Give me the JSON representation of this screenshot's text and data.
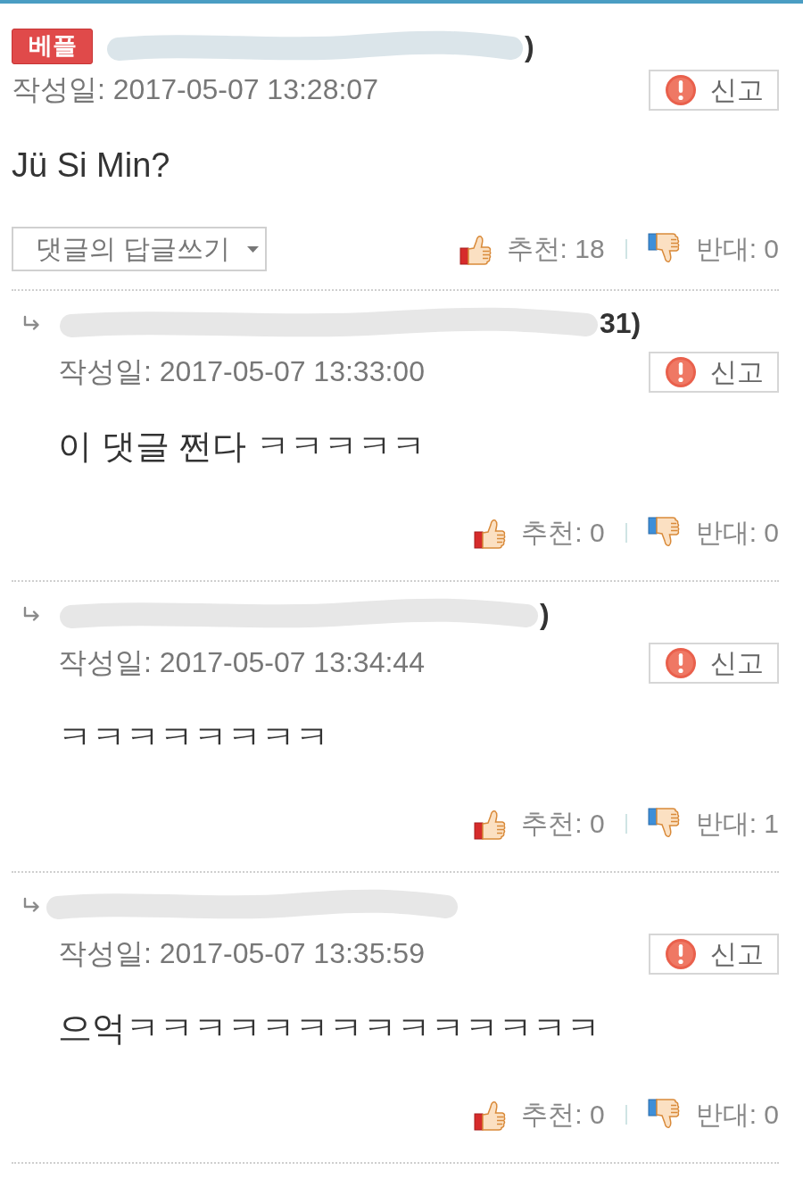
{
  "comments": [
    {
      "kind": "comment",
      "badge": "베플",
      "author_fragment": ")",
      "date": "작성일: 2017-05-07 13:28:07",
      "report": "신고",
      "body": "Jü Si Min?",
      "reply_button": "댓글의 답글쓰기",
      "upvotes": "추천: 18",
      "downvotes": "반대: 0"
    },
    {
      "kind": "reply",
      "author_fragment": "31)",
      "date": "작성일: 2017-05-07 13:33:00",
      "report": "신고",
      "body": "이 댓글 쩐다 ㅋㅋㅋㅋㅋ",
      "upvotes": "추천: 0",
      "downvotes": "반대: 0"
    },
    {
      "kind": "reply",
      "author_fragment": ")",
      "date": "작성일: 2017-05-07 13:34:44",
      "report": "신고",
      "body": "ㅋㅋㅋㅋㅋㅋㅋㅋ",
      "upvotes": "추천: 0",
      "downvotes": "반대: 1"
    },
    {
      "kind": "reply",
      "date": "작성일: 2017-05-07 13:35:59",
      "report": "신고",
      "body": "으억ㅋㅋㅋㅋㅋㅋㅋㅋㅋㅋㅋㅋㅋㅋ",
      "upvotes": "추천: 0",
      "downvotes": "반대: 0"
    }
  ]
}
